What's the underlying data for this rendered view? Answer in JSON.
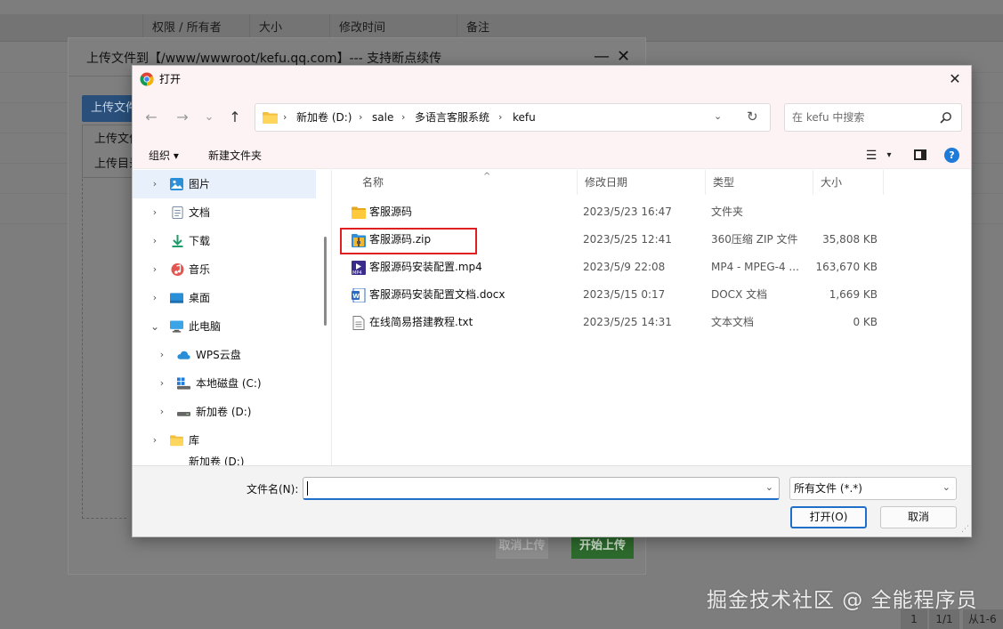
{
  "background": {
    "columns": [
      "权限 / 所有者",
      "大小",
      "修改时间",
      "备注"
    ],
    "pager": {
      "page": "1",
      "total": "1/1",
      "range": "从1-6"
    },
    "watermark": "掘金技术社区 @ 全能程序员"
  },
  "upload_dialog": {
    "title": "上传文件到【/www/wwwroot/kefu.qq.com】--- 支持断点续传",
    "minimize": "—",
    "close": "✕",
    "upload_button": "上传文件",
    "menu_items": [
      "上传文件",
      "上传目录"
    ],
    "cancel_upload": "取消上传",
    "start_upload": "开始上传"
  },
  "open_dialog": {
    "title": "打开",
    "close": "✕",
    "nav": {
      "back": "←",
      "forward": "→",
      "recent": "⌄",
      "up": "↑"
    },
    "breadcrumb": [
      "新加卷 (D:)",
      "sale",
      "多语言客服系统",
      "kefu"
    ],
    "breadcrumb_sep": "›",
    "search_placeholder": "在 kefu 中搜索",
    "toolbar": {
      "organize": "组织 ▾",
      "new_folder": "新建文件夹",
      "view": "☰",
      "view_dd": "▾",
      "help": "?"
    },
    "tree": [
      {
        "label": "图片",
        "icon": "pictures-icon",
        "expand": "›"
      },
      {
        "label": "文档",
        "icon": "documents-icon",
        "expand": "›"
      },
      {
        "label": "下载",
        "icon": "download-icon",
        "expand": "›"
      },
      {
        "label": "音乐",
        "icon": "music-icon",
        "expand": "›"
      },
      {
        "label": "桌面",
        "icon": "desktop-icon",
        "expand": "›"
      },
      {
        "label": "此电脑",
        "icon": "computer-icon",
        "expand": "⌄"
      },
      {
        "label": "WPS云盘",
        "icon": "cloud-icon",
        "expand": "›"
      },
      {
        "label": "本地磁盘 (C:)",
        "icon": "windows-drive-icon",
        "expand": "›"
      },
      {
        "label": "新加卷 (D:)",
        "icon": "drive-icon",
        "expand": "›"
      },
      {
        "label": "库",
        "icon": "library-icon",
        "expand": "›"
      },
      {
        "label": "新加卷 (D:)",
        "icon": "drive-icon",
        "expand": ""
      }
    ],
    "columns": {
      "name": "名称",
      "date": "修改日期",
      "type": "类型",
      "size": "大小",
      "sort": "^"
    },
    "files": [
      {
        "name": "客服源码",
        "date": "2023/5/23 16:47",
        "type": "文件夹",
        "size": "",
        "icon": "folder-icon"
      },
      {
        "name": "客服源码.zip",
        "date": "2023/5/25 12:41",
        "type": "360压缩 ZIP 文件",
        "size": "35,808 KB",
        "icon": "zip-icon"
      },
      {
        "name": "客服源码安装配置.mp4",
        "date": "2023/5/9 22:08",
        "type": "MP4 - MPEG-4 ...",
        "size": "163,670 KB",
        "icon": "video-icon"
      },
      {
        "name": "客服源码安装配置文档.docx",
        "date": "2023/5/15 0:17",
        "type": "DOCX 文档",
        "size": "1,669 KB",
        "icon": "word-icon"
      },
      {
        "name": "在线简易搭建教程.txt",
        "date": "2023/5/25 14:31",
        "type": "文本文档",
        "size": "0 KB",
        "icon": "text-file-icon"
      }
    ],
    "filename_label": "文件名(N):",
    "filename_value": "",
    "filter": "所有文件 (*.*)",
    "open_button": "打开(O)",
    "cancel_button": "取消"
  },
  "colors": {
    "accent": "#1f6fc9",
    "highlight": "#e02020",
    "folder": "#f3c03e"
  }
}
